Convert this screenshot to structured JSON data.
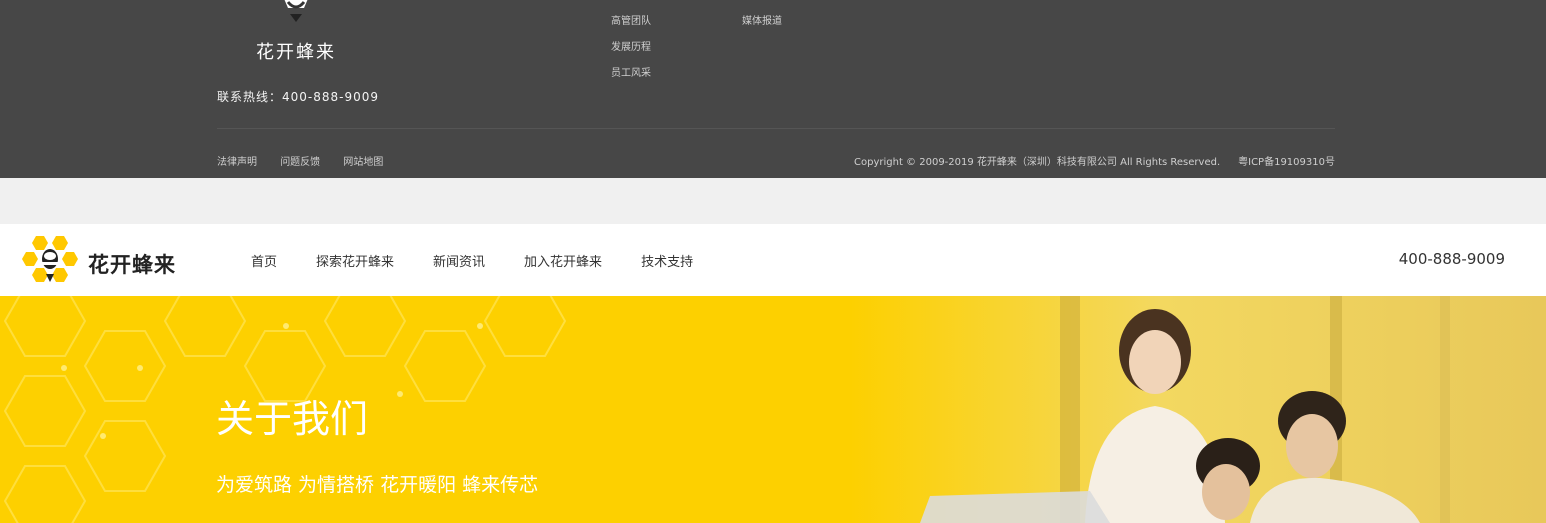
{
  "footer": {
    "brand": "花开蜂来",
    "hotline": "联系热线：400-888-9009",
    "links_col1": [
      "高管团队",
      "发展历程",
      "员工风采"
    ],
    "links_col2": [
      "媒体报道"
    ],
    "legal": [
      "法律声明",
      "问题反馈",
      "网站地图"
    ],
    "copyright": "Copyright © 2009-2019 花开蜂来（深圳）科技有限公司 All Rights Reserved.",
    "icp": "粤ICP备19109310号"
  },
  "nav": {
    "brand": "花开蜂来",
    "items": [
      "首页",
      "探索花开蜂来",
      "新闻资讯",
      "加入花开蜂来",
      "技术支持"
    ],
    "phone": "400-888-9009"
  },
  "banner": {
    "title": "关于我们",
    "subtitle": "为爱筑路 为情搭桥 花开暖阳 蜂来传芯"
  },
  "colors": {
    "footer_bg": "#474747",
    "accent_yellow": "#fdd000",
    "separator_bg": "#f0f0f0"
  },
  "icons": [
    "bee-logo-icon"
  ]
}
